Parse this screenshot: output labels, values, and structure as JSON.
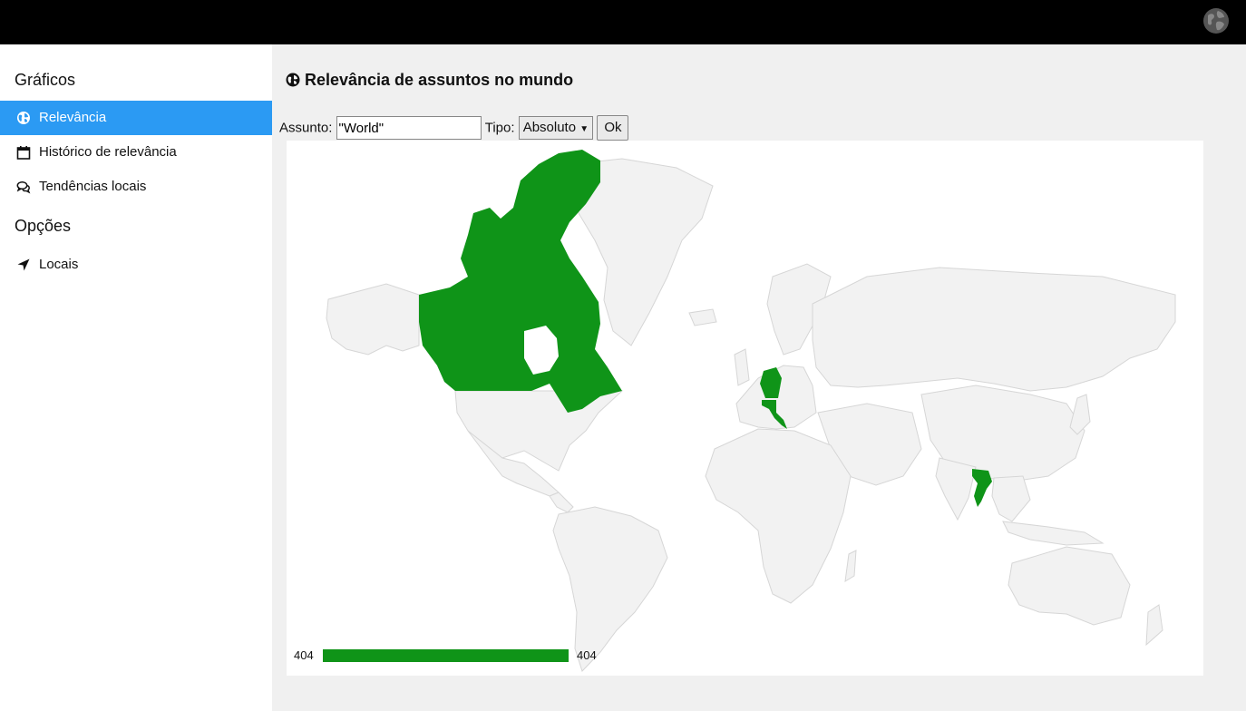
{
  "sidebar": {
    "section_graphs": "Gráficos",
    "items": [
      {
        "label": "Relevância",
        "icon": "globe-icon",
        "active": true
      },
      {
        "label": "Histórico de relevância",
        "icon": "calendar-icon",
        "active": false
      },
      {
        "label": "Tendências locais",
        "icon": "comments-icon",
        "active": false
      }
    ],
    "section_options": "Opções",
    "option_items": [
      {
        "label": "Locais",
        "icon": "location-arrow-icon"
      }
    ]
  },
  "main": {
    "title": "Relevância de assuntos no mundo",
    "form": {
      "subject_label": "Assunto:",
      "subject_value": "\"World\"",
      "type_label": "Tipo:",
      "type_selected": "Absoluto",
      "ok_label": "Ok"
    },
    "map": {
      "highlight_color": "#0f9418",
      "base_color": "#f2f2f2",
      "highlighted_countries": [
        "Canada",
        "Germany",
        "Italy",
        "Thailand"
      ],
      "legend_min": "404",
      "legend_max": "404"
    }
  }
}
